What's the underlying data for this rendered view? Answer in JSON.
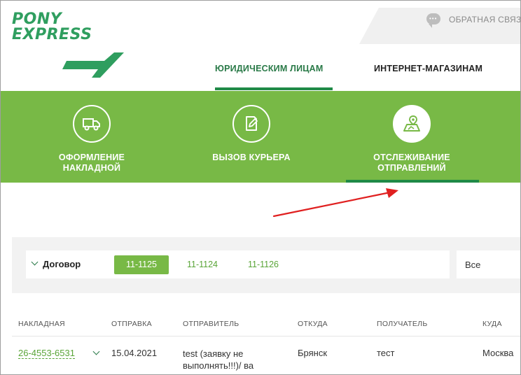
{
  "brand": {
    "line1": "PONY",
    "line2": "EXPRESS"
  },
  "header": {
    "feedback_label": "ОБРАТНАЯ СВЯЗЬ"
  },
  "nav": {
    "legal": "ЮРИДИЧЕСКИМ ЛИЦАМ",
    "shops": "ИНТЕРНЕТ-МАГАЗИНАМ"
  },
  "services": [
    {
      "line1": "ОФОРМЛЕНИЕ",
      "line2": "НАКЛАДНОЙ",
      "icon": "truck-icon"
    },
    {
      "line1": "ВЫЗОВ КУРЬЕРА",
      "line2": "",
      "icon": "edit-document-icon"
    },
    {
      "line1": "ОТСЛЕЖИВАНИЕ",
      "line2": "ОТПРАВЛЕНИЙ",
      "icon": "map-pin-icon",
      "active": true
    }
  ],
  "filter": {
    "label": "Договор",
    "contracts": [
      "11-1125",
      "11-1124",
      "11-1126"
    ],
    "selected": "11-1125",
    "status_value": "Все"
  },
  "table": {
    "headers": [
      "НАКЛАДНАЯ",
      "ОТПРАВКА",
      "ОТПРАВИТЕЛЬ",
      "ОТКУДА",
      "ПОЛУЧАТЕЛЬ",
      "КУДА"
    ],
    "rows": [
      {
        "waybill": "26-4553-6531",
        "date": "15.04.2021",
        "sender": "test (заявку не выполнять!!!)/ ва",
        "from": "Брянск",
        "recipient": "тест",
        "to": "Москва"
      }
    ]
  },
  "colors": {
    "brand_green": "#2f9e5f",
    "band_green": "#78b946",
    "accent_dark_green": "#1f8a47",
    "arrow_red": "#e02020"
  }
}
